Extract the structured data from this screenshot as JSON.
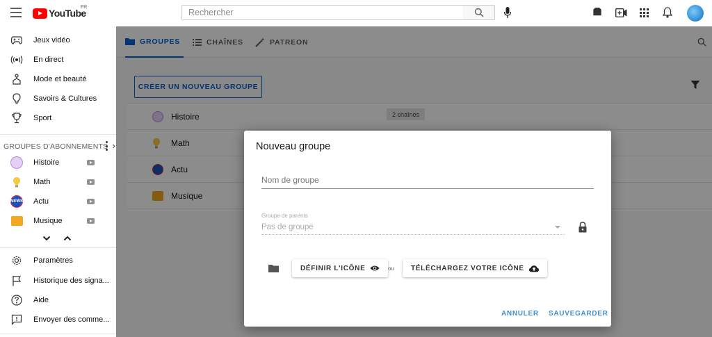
{
  "header": {
    "logo_text": "YouTube",
    "country_code": "FR",
    "search_placeholder": "Rechercher",
    "icons": [
      "menu-icon",
      "search-icon",
      "mic-icon",
      "tag-icon",
      "create-video-icon",
      "apps-grid-icon",
      "bell-icon",
      "avatar"
    ]
  },
  "sidebar": {
    "top_items": [
      {
        "label": "Jeux vidéo",
        "icon": "gamepad-icon"
      },
      {
        "label": "En direct",
        "icon": "live-icon"
      },
      {
        "label": "Mode et beauté",
        "icon": "hanger-icon"
      },
      {
        "label": "Savoirs & Cultures",
        "icon": "bulb-icon"
      },
      {
        "label": "Sport",
        "icon": "trophy-icon"
      }
    ],
    "section_title": "Groupes d'abonnements",
    "section_chevron": "›",
    "groups": [
      {
        "label": "Histoire",
        "color": "#b58ad8"
      },
      {
        "label": "Math",
        "color": "#f6c945"
      },
      {
        "label": "Actu",
        "color": "#1f4fbf"
      },
      {
        "label": "Musique",
        "color": "#f0a81e"
      }
    ],
    "bottom_items": [
      {
        "label": "Paramètres",
        "icon": "gear-icon"
      },
      {
        "label": "Historique des signa...",
        "icon": "flag-icon"
      },
      {
        "label": "Aide",
        "icon": "help-icon"
      },
      {
        "label": "Envoyer des comme...",
        "icon": "feedback-icon"
      }
    ]
  },
  "main": {
    "tabs": [
      {
        "label": "Groupes",
        "active": true,
        "icon": "folder-icon"
      },
      {
        "label": "Chaînes",
        "active": false,
        "icon": "list-icon"
      },
      {
        "label": "Patreon",
        "active": false,
        "icon": "magic-wand-icon"
      }
    ],
    "create_button": "Créer un nouveau groupe",
    "groups": [
      {
        "label": "Histoire",
        "chip": "2 chaînes"
      },
      {
        "label": "Math"
      },
      {
        "label": "Actu"
      },
      {
        "label": "Musique"
      }
    ]
  },
  "dialog": {
    "title": "Nouveau groupe",
    "name_placeholder": "Nom de groupe",
    "parent_label": "Groupe de parents",
    "parent_value": "Pas de groupe",
    "define_icon_button": "Définir l'icône",
    "or_text": "ou",
    "upload_icon_button": "Téléchargez votre icône",
    "cancel_button": "Annuler",
    "save_button": "Sauvegarder"
  },
  "colors": {
    "accent_blue": "#065fd4",
    "dialog_action": "#3f8fcf",
    "youtube_red": "#ff0000"
  }
}
